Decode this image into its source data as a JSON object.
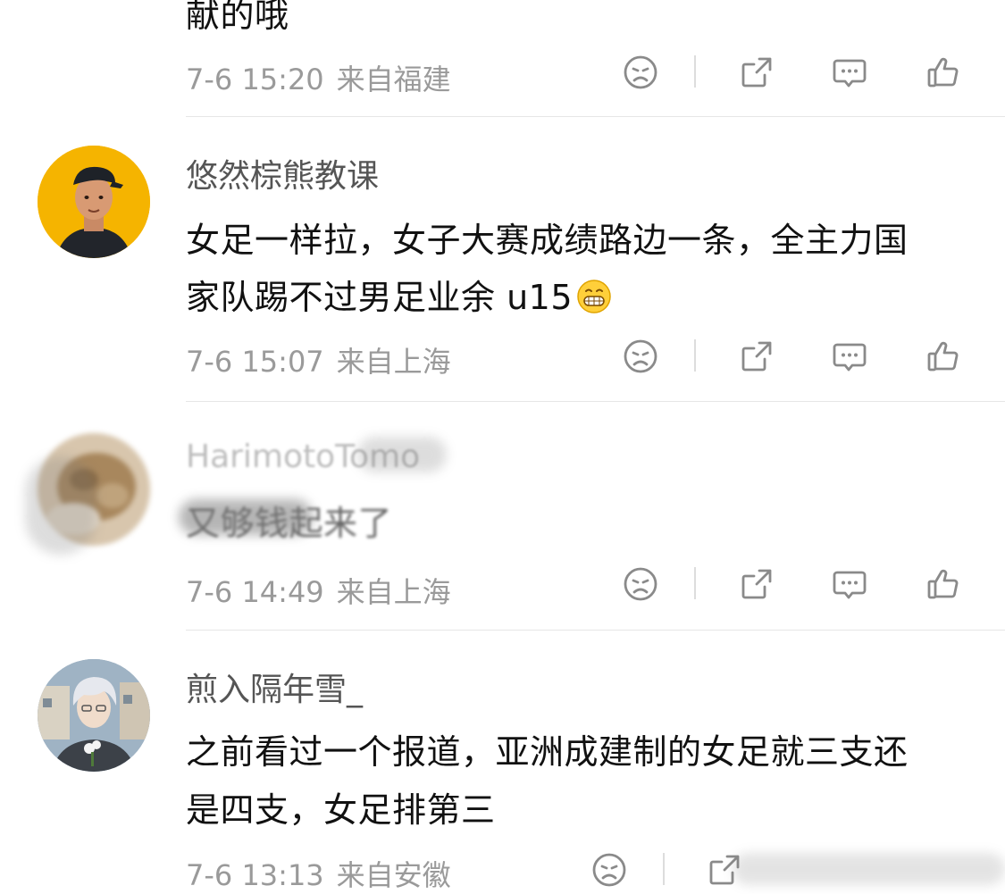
{
  "top_partial": {
    "text_fragment": "献的哦",
    "time": "7-6 15:20",
    "location": "来自福建"
  },
  "comments": [
    {
      "username": "悠然棕熊教课",
      "lines": [
        "女足一样拉，女子大赛成绩路边一条，全主力国",
        "家队踢不过男足业余 u15"
      ],
      "emoji": "grinning-face-icon",
      "time": "7-6 15:07",
      "location": "来自上海"
    },
    {
      "username": "HarimotoTomo",
      "lines": [
        "又够钱起来了"
      ],
      "time": "7-6 14:49",
      "location": "来自上海"
    },
    {
      "username": "煎入隔年雪_",
      "lines": [
        "之前看过一个报道，亚洲成建制的女足就三支还",
        "是四支，女足排第三"
      ],
      "time": "7-6 13:13",
      "location": "来自安徽"
    }
  ],
  "icons": {
    "dislike": "sad-face-icon",
    "share": "share-icon",
    "reply": "comment-icon",
    "like": "thumbs-up-icon"
  },
  "colors": {
    "meta": "#9a9a9a",
    "username": "#555555",
    "text": "#111111",
    "icon": "#8a8a8a",
    "avatar1_bg": "#f5b400"
  }
}
